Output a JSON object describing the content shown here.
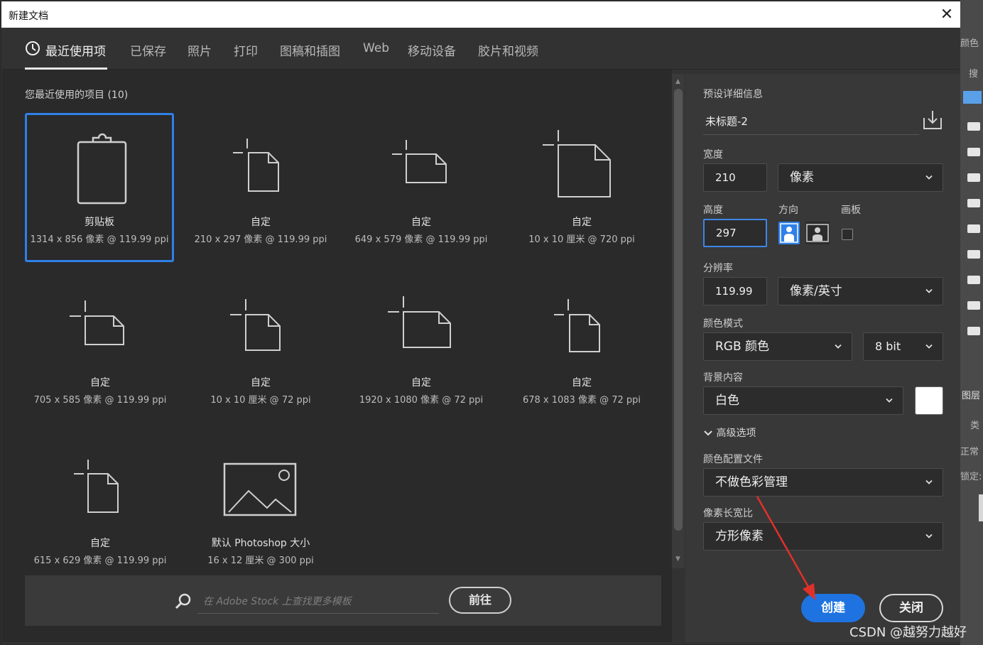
{
  "window": {
    "title": "新建文档",
    "close_glyph": "✕"
  },
  "tabs": [
    {
      "label": "最近使用项",
      "icon": "clock-icon",
      "active": true
    },
    {
      "label": "已保存"
    },
    {
      "label": "照片"
    },
    {
      "label": "打印"
    },
    {
      "label": "图稿和插图"
    },
    {
      "label": "Web"
    },
    {
      "label": "移动设备"
    },
    {
      "label": "胶片和视频"
    }
  ],
  "recent": {
    "title": "您最近使用的项目",
    "count": "(10)",
    "items": [
      {
        "name": "剪贴板",
        "meta": "1314 x 856 像素 @ 119.99 ppi",
        "icon": "clipboard-icon",
        "selected": true
      },
      {
        "name": "自定",
        "meta": "210 x 297 像素 @ 119.99 ppi",
        "icon": "portrait-doc-icon"
      },
      {
        "name": "自定",
        "meta": "649 x 579 像素 @ 119.99 ppi",
        "icon": "landscape-doc-icon"
      },
      {
        "name": "自定",
        "meta": "10 x 10 厘米 @ 720 ppi",
        "icon": "square-doc-icon"
      },
      {
        "name": "自定",
        "meta": "705 x 585 像素 @ 119.99 ppi",
        "icon": "landscape-doc-icon"
      },
      {
        "name": "自定",
        "meta": "10 x 10 厘米 @ 72 ppi",
        "icon": "portrait-doc-icon"
      },
      {
        "name": "自定",
        "meta": "1920 x 1080 像素 @ 72 ppi",
        "icon": "wide-doc-icon"
      },
      {
        "name": "自定",
        "meta": "678 x 1083 像素 @ 72 ppi",
        "icon": "tall-doc-icon"
      },
      {
        "name": "自定",
        "meta": "615 x 629 像素 @ 119.99 ppi",
        "icon": "portrait-doc-icon"
      },
      {
        "name": "默认 Photoshop 大小",
        "meta": "16 x 12 厘米 @ 300 ppi",
        "icon": "image-icon"
      }
    ]
  },
  "search": {
    "placeholder": "在 Adobe Stock 上查找更多模板",
    "go_label": "前往"
  },
  "details": {
    "section_title": "预设详细信息",
    "doc_name": "未标题-2",
    "width_label": "宽度",
    "width_value": "210",
    "width_unit": "像素",
    "height_label": "高度",
    "height_value": "297",
    "orientation_label": "方向",
    "artboard_label": "画板",
    "resolution_label": "分辨率",
    "resolution_value": "119.99",
    "resolution_unit": "像素/英寸",
    "color_mode_label": "颜色模式",
    "color_mode": "RGB 颜色",
    "bit_depth": "8 bit",
    "background_label": "背景内容",
    "background": "白色",
    "background_swatch": "#ffffff",
    "advanced_label": "高级选项",
    "profile_label": "颜色配置文件",
    "profile": "不做色彩管理",
    "aspect_label": "像素长宽比",
    "aspect": "方形像素",
    "create_label": "创建",
    "close_label": "关闭"
  },
  "background_app": {
    "strip_texts": [
      "颜色",
      "搜",
      "图层",
      "类",
      "正常",
      "锁定:"
    ]
  },
  "watermark": "CSDN @越努力越好",
  "colors": {
    "accent": "#1f73e0",
    "selection": "#2f80e8",
    "annotation_arrow": "#e0302a"
  }
}
